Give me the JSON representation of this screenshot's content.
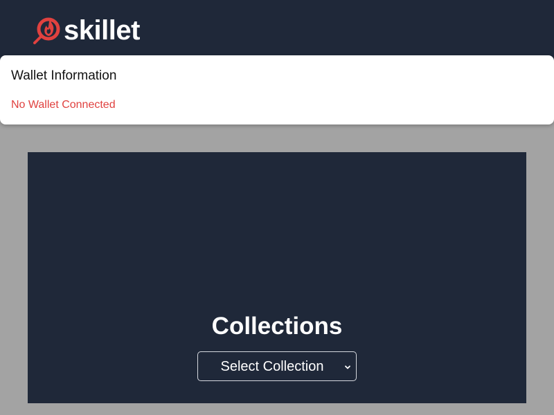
{
  "header": {
    "logo_text": "skillet",
    "logo_icon": "skillet-flame-icon",
    "background": "#1f2839",
    "accent": "#e0413f"
  },
  "wallet": {
    "title": "Wallet Information",
    "status": "No Wallet Connected",
    "status_color": "#e0413f"
  },
  "collections": {
    "title": "Collections",
    "select_value": "Select Collection"
  }
}
